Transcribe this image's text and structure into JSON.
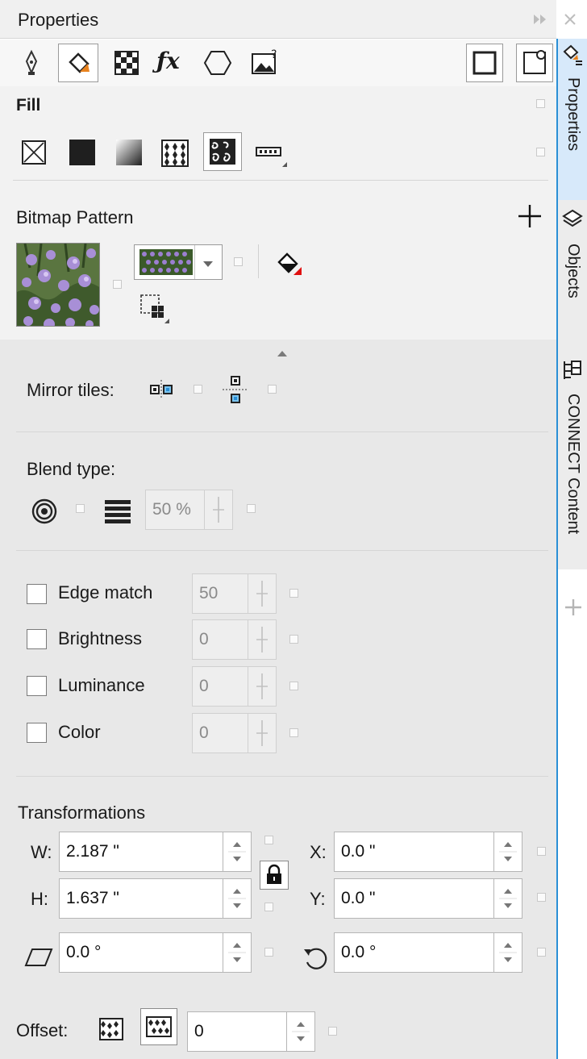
{
  "header": {
    "title": "Properties"
  },
  "fill": {
    "title": "Fill"
  },
  "bitmap_pattern": {
    "title": "Bitmap Pattern"
  },
  "mirror": {
    "label": "Mirror tiles:"
  },
  "blend": {
    "label": "Blend type:",
    "percent": "50 %"
  },
  "adjust": {
    "edge_match": {
      "label": "Edge match",
      "value": "50"
    },
    "brightness": {
      "label": "Brightness",
      "value": "0"
    },
    "luminance": {
      "label": "Luminance",
      "value": "0"
    },
    "color": {
      "label": "Color",
      "value": "0"
    }
  },
  "transform": {
    "title": "Transformations",
    "w_label": "W:",
    "w": "2.187 \"",
    "h_label": "H:",
    "h": "1.637 \"",
    "x_label": "X:",
    "x": "0.0 \"",
    "y_label": "Y:",
    "y": "0.0 \"",
    "skew": "0.0 °",
    "rotate": "0.0 °"
  },
  "offset": {
    "label": "Offset:",
    "value": "0"
  },
  "side_tabs": {
    "properties": "Properties",
    "objects": "Objects",
    "connect": "CONNECT Content"
  },
  "colors": {
    "accent": "#2a8fd6",
    "tab_active": "#d7e9fa",
    "panel": "#f2f2f2",
    "section": "#e8e8e8"
  }
}
